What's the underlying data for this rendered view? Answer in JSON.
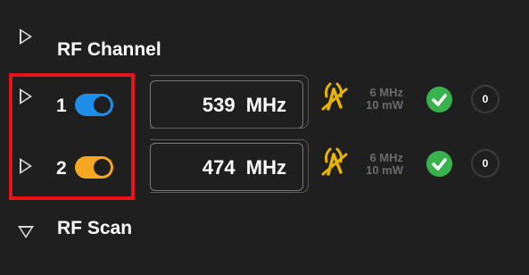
{
  "sections": {
    "rf_channel": {
      "title": "RF Channel",
      "expanded": false
    },
    "rf_scan": {
      "title": "RF Scan",
      "expanded": true
    }
  },
  "channels": [
    {
      "number": "1",
      "toggle_state": "on",
      "toggle_color": "#1e8ee8",
      "frequency": "539  MHz",
      "bandwidth": "6 MHz",
      "power": "10 mW",
      "status": "ok",
      "count": "0"
    },
    {
      "number": "2",
      "toggle_state": "on",
      "toggle_color": "#f5a623",
      "frequency": "474  MHz",
      "bandwidth": "6 MHz",
      "power": "10 mW",
      "status": "ok",
      "count": "0"
    }
  ],
  "colors": {
    "background": "#1f1f1f",
    "accent_blue": "#1e8ee8",
    "accent_amber": "#f5a623",
    "antenna": "#e8b400",
    "ok_green": "#37b24d",
    "highlight_red": "#e8141b"
  },
  "icons": {
    "collapsed": "triangle-right-icon",
    "expanded": "triangle-down-icon",
    "antenna": "antenna-signal-icon",
    "status": "check-circle-icon"
  }
}
